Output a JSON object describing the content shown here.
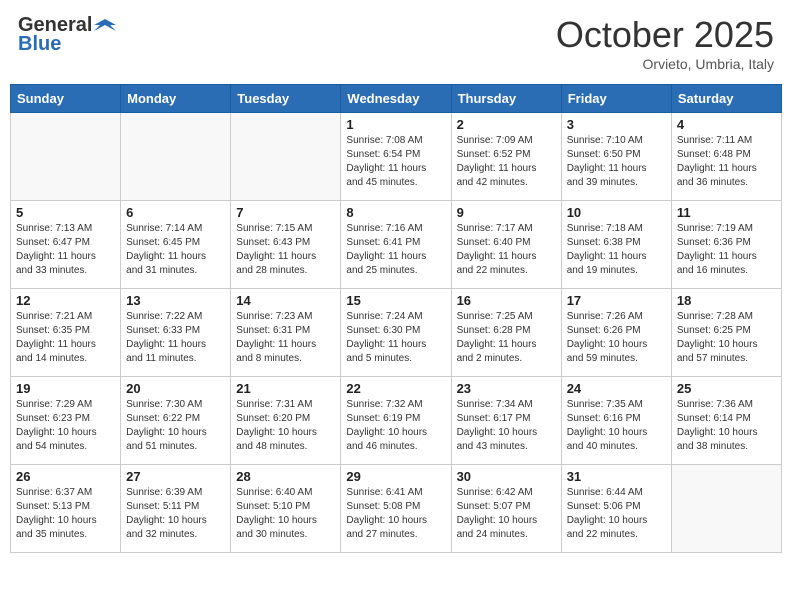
{
  "header": {
    "logo_general": "General",
    "logo_blue": "Blue",
    "month": "October 2025",
    "location": "Orvieto, Umbria, Italy"
  },
  "days_of_week": [
    "Sunday",
    "Monday",
    "Tuesday",
    "Wednesday",
    "Thursday",
    "Friday",
    "Saturday"
  ],
  "weeks": [
    [
      {
        "day": "",
        "info": ""
      },
      {
        "day": "",
        "info": ""
      },
      {
        "day": "",
        "info": ""
      },
      {
        "day": "1",
        "info": "Sunrise: 7:08 AM\nSunset: 6:54 PM\nDaylight: 11 hours and 45 minutes."
      },
      {
        "day": "2",
        "info": "Sunrise: 7:09 AM\nSunset: 6:52 PM\nDaylight: 11 hours and 42 minutes."
      },
      {
        "day": "3",
        "info": "Sunrise: 7:10 AM\nSunset: 6:50 PM\nDaylight: 11 hours and 39 minutes."
      },
      {
        "day": "4",
        "info": "Sunrise: 7:11 AM\nSunset: 6:48 PM\nDaylight: 11 hours and 36 minutes."
      }
    ],
    [
      {
        "day": "5",
        "info": "Sunrise: 7:13 AM\nSunset: 6:47 PM\nDaylight: 11 hours and 33 minutes."
      },
      {
        "day": "6",
        "info": "Sunrise: 7:14 AM\nSunset: 6:45 PM\nDaylight: 11 hours and 31 minutes."
      },
      {
        "day": "7",
        "info": "Sunrise: 7:15 AM\nSunset: 6:43 PM\nDaylight: 11 hours and 28 minutes."
      },
      {
        "day": "8",
        "info": "Sunrise: 7:16 AM\nSunset: 6:41 PM\nDaylight: 11 hours and 25 minutes."
      },
      {
        "day": "9",
        "info": "Sunrise: 7:17 AM\nSunset: 6:40 PM\nDaylight: 11 hours and 22 minutes."
      },
      {
        "day": "10",
        "info": "Sunrise: 7:18 AM\nSunset: 6:38 PM\nDaylight: 11 hours and 19 minutes."
      },
      {
        "day": "11",
        "info": "Sunrise: 7:19 AM\nSunset: 6:36 PM\nDaylight: 11 hours and 16 minutes."
      }
    ],
    [
      {
        "day": "12",
        "info": "Sunrise: 7:21 AM\nSunset: 6:35 PM\nDaylight: 11 hours and 14 minutes."
      },
      {
        "day": "13",
        "info": "Sunrise: 7:22 AM\nSunset: 6:33 PM\nDaylight: 11 hours and 11 minutes."
      },
      {
        "day": "14",
        "info": "Sunrise: 7:23 AM\nSunset: 6:31 PM\nDaylight: 11 hours and 8 minutes."
      },
      {
        "day": "15",
        "info": "Sunrise: 7:24 AM\nSunset: 6:30 PM\nDaylight: 11 hours and 5 minutes."
      },
      {
        "day": "16",
        "info": "Sunrise: 7:25 AM\nSunset: 6:28 PM\nDaylight: 11 hours and 2 minutes."
      },
      {
        "day": "17",
        "info": "Sunrise: 7:26 AM\nSunset: 6:26 PM\nDaylight: 10 hours and 59 minutes."
      },
      {
        "day": "18",
        "info": "Sunrise: 7:28 AM\nSunset: 6:25 PM\nDaylight: 10 hours and 57 minutes."
      }
    ],
    [
      {
        "day": "19",
        "info": "Sunrise: 7:29 AM\nSunset: 6:23 PM\nDaylight: 10 hours and 54 minutes."
      },
      {
        "day": "20",
        "info": "Sunrise: 7:30 AM\nSunset: 6:22 PM\nDaylight: 10 hours and 51 minutes."
      },
      {
        "day": "21",
        "info": "Sunrise: 7:31 AM\nSunset: 6:20 PM\nDaylight: 10 hours and 48 minutes."
      },
      {
        "day": "22",
        "info": "Sunrise: 7:32 AM\nSunset: 6:19 PM\nDaylight: 10 hours and 46 minutes."
      },
      {
        "day": "23",
        "info": "Sunrise: 7:34 AM\nSunset: 6:17 PM\nDaylight: 10 hours and 43 minutes."
      },
      {
        "day": "24",
        "info": "Sunrise: 7:35 AM\nSunset: 6:16 PM\nDaylight: 10 hours and 40 minutes."
      },
      {
        "day": "25",
        "info": "Sunrise: 7:36 AM\nSunset: 6:14 PM\nDaylight: 10 hours and 38 minutes."
      }
    ],
    [
      {
        "day": "26",
        "info": "Sunrise: 6:37 AM\nSunset: 5:13 PM\nDaylight: 10 hours and 35 minutes."
      },
      {
        "day": "27",
        "info": "Sunrise: 6:39 AM\nSunset: 5:11 PM\nDaylight: 10 hours and 32 minutes."
      },
      {
        "day": "28",
        "info": "Sunrise: 6:40 AM\nSunset: 5:10 PM\nDaylight: 10 hours and 30 minutes."
      },
      {
        "day": "29",
        "info": "Sunrise: 6:41 AM\nSunset: 5:08 PM\nDaylight: 10 hours and 27 minutes."
      },
      {
        "day": "30",
        "info": "Sunrise: 6:42 AM\nSunset: 5:07 PM\nDaylight: 10 hours and 24 minutes."
      },
      {
        "day": "31",
        "info": "Sunrise: 6:44 AM\nSunset: 5:06 PM\nDaylight: 10 hours and 22 minutes."
      },
      {
        "day": "",
        "info": ""
      }
    ]
  ]
}
